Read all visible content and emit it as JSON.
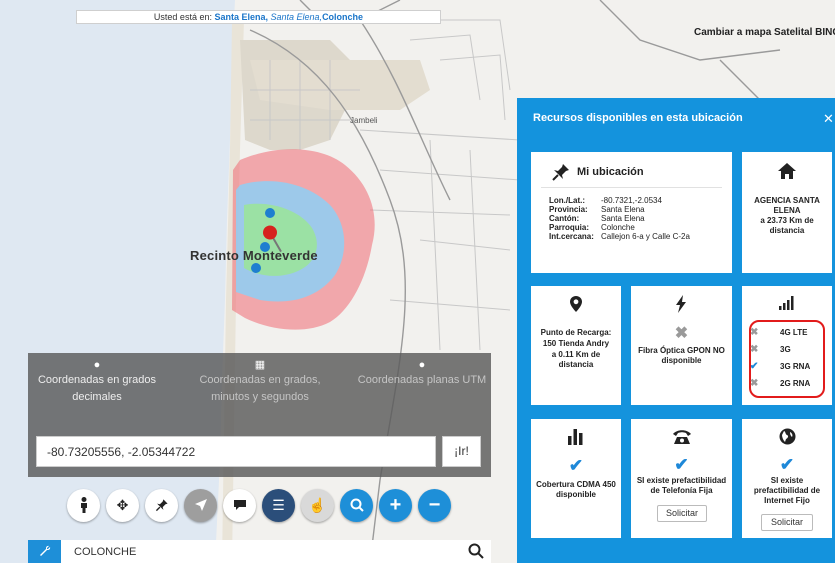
{
  "map": {
    "breadcrumb": {
      "prefix": "Usted está en: ",
      "province": "Santa Elena,",
      "canton": "Santa Elena,",
      "parish": "Colonche"
    },
    "sat_link": "Cambiar a mapa Satelital BING",
    "labels": {
      "town": "Recinto Monteverde",
      "jambeli": "Jambeli"
    },
    "colors": {
      "coverage_outer": "#f06a74",
      "coverage_mid": "#8ecff5",
      "coverage_inner": "#9be39c",
      "accent": "#1493dd"
    }
  },
  "panel": {
    "title": "Recursos disponibles en esta ubicación",
    "close": "✕",
    "mi_ubicacion": {
      "title": "Mi ubicación",
      "rows": [
        {
          "k": "Lon./Lat.:",
          "v": "-80.7321,-2.0534"
        },
        {
          "k": "Provincia:",
          "v": "Santa Elena"
        },
        {
          "k": "Cantón:",
          "v": "Santa Elena"
        },
        {
          "k": "Parroquia:",
          "v": "Colonche"
        },
        {
          "k": "Int.cercana:",
          "v": "Callejon 6-a y Calle C-2a"
        }
      ]
    },
    "agencia": {
      "icon": "home-icon",
      "name": "AGENCIA SANTA ELENA",
      "distance": "a 23.73 Km de distancia"
    },
    "recarga": {
      "icon": "map-pin-icon",
      "title": "Punto de Recarga:",
      "name": "150 Tienda Andry",
      "distance": "a 0.11 Km de distancia"
    },
    "fibra": {
      "icon": "bolt-icon",
      "status": "✖",
      "text": "Fibra Óptica GPON NO disponible"
    },
    "redes": {
      "icon": "signal-bars-icon",
      "items": [
        {
          "status": "✖",
          "label": "4G LTE"
        },
        {
          "status": "✖",
          "label": "3G"
        },
        {
          "status": "✔",
          "label": "3G RNA"
        },
        {
          "status": "✖",
          "label": "2G RNA"
        }
      ]
    },
    "cdma": {
      "icon": "bar-chart-icon",
      "status": "✔",
      "text": "Cobertura CDMA 450 disponible"
    },
    "fija": {
      "icon": "phone-icon",
      "status": "✔",
      "text": "SI existe prefactibilidad de Telefonía Fija",
      "button": "Solicitar"
    },
    "internet": {
      "icon": "globe-icon",
      "status": "✔",
      "text": "SI existe prefactibilidad de Internet Fijo",
      "button": "Solicitar"
    }
  },
  "coords": {
    "tabs": [
      "Coordenadas en grados decimales",
      "Coordenadas en grados, minutos y segundos",
      "Coordenadas planas UTM"
    ],
    "value": "-80.73205556, -2.05344722",
    "go": "¡Ir!"
  },
  "toolbar": [
    "person-icon",
    "move-icon",
    "pin-icon",
    "navigate-icon",
    "comment-icon",
    "list-icon",
    "touch-icon",
    "zoom-search-icon",
    "zoom-in-icon",
    "zoom-out-icon"
  ],
  "search": {
    "value": "COLONCHE"
  }
}
